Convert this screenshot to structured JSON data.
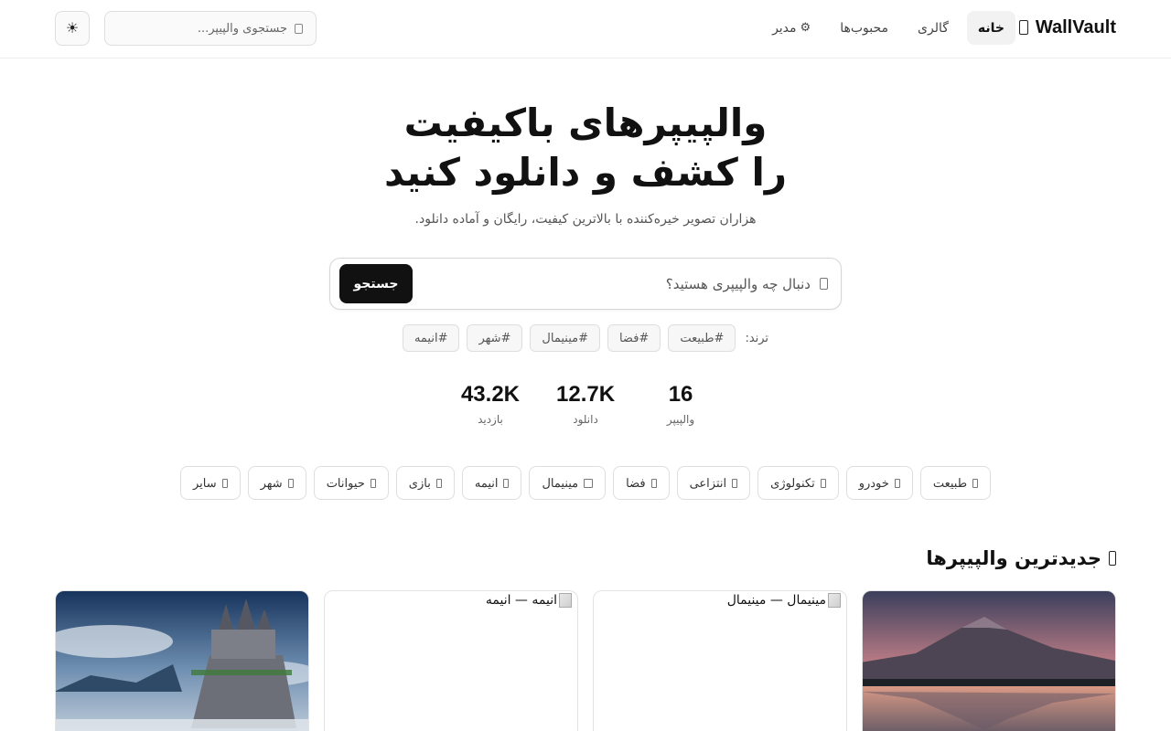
{
  "app": {
    "brand": "WallVault"
  },
  "nav": {
    "items": [
      {
        "label": "خانه",
        "active": true
      },
      {
        "label": "گالری",
        "active": false
      },
      {
        "label": "محبوب‌ها",
        "active": false
      },
      {
        "label": "مدیر",
        "active": false,
        "icon": "gear-icon"
      }
    ]
  },
  "header": {
    "search_placeholder": "جستجوی والپیپر...",
    "theme_toggle_icon": "☀"
  },
  "hero": {
    "title_line1": "والپیپرهای باکیفیت",
    "title_line2": "را کشف و دانلود کنید",
    "subtitle": "هزاران تصویر خیره‌کننده با بالاترین کیفیت، رایگان و آماده دانلود.",
    "search_placeholder": "دنبال چه والپیپری هستید؟",
    "search_button": "جستجو"
  },
  "trends": {
    "label": "ترند:",
    "tags": [
      "#طبیعت",
      "#فضا",
      "#مینیمال",
      "#شهر",
      "#انیمه"
    ]
  },
  "stats": [
    {
      "value": "16",
      "label": "والپیپر"
    },
    {
      "value": "12.7K",
      "label": "دانلود"
    },
    {
      "value": "43.2K",
      "label": "بازدید"
    }
  ],
  "categories": [
    {
      "label": "طبیعت"
    },
    {
      "label": "خودرو"
    },
    {
      "label": "تکنولوژی"
    },
    {
      "label": "انتزاعی"
    },
    {
      "label": "فضا"
    },
    {
      "label": "مینیمال"
    },
    {
      "label": "انیمه"
    },
    {
      "label": "بازی"
    },
    {
      "label": "حیوانات"
    },
    {
      "label": "شهر"
    },
    {
      "label": "سایر"
    }
  ],
  "latest": {
    "title": "جدیدترین والپیپرها",
    "cards": [
      {
        "type": "image",
        "subject": "mountain-lake-sunset"
      },
      {
        "type": "broken",
        "alt": "مینیمال — مینیمال"
      },
      {
        "type": "broken",
        "alt": "انیمه — انیمه"
      },
      {
        "type": "image",
        "subject": "castle-on-cliff"
      }
    ]
  },
  "colors": {
    "accent": "#111111",
    "border": "#dedede",
    "muted_text": "#555555"
  }
}
